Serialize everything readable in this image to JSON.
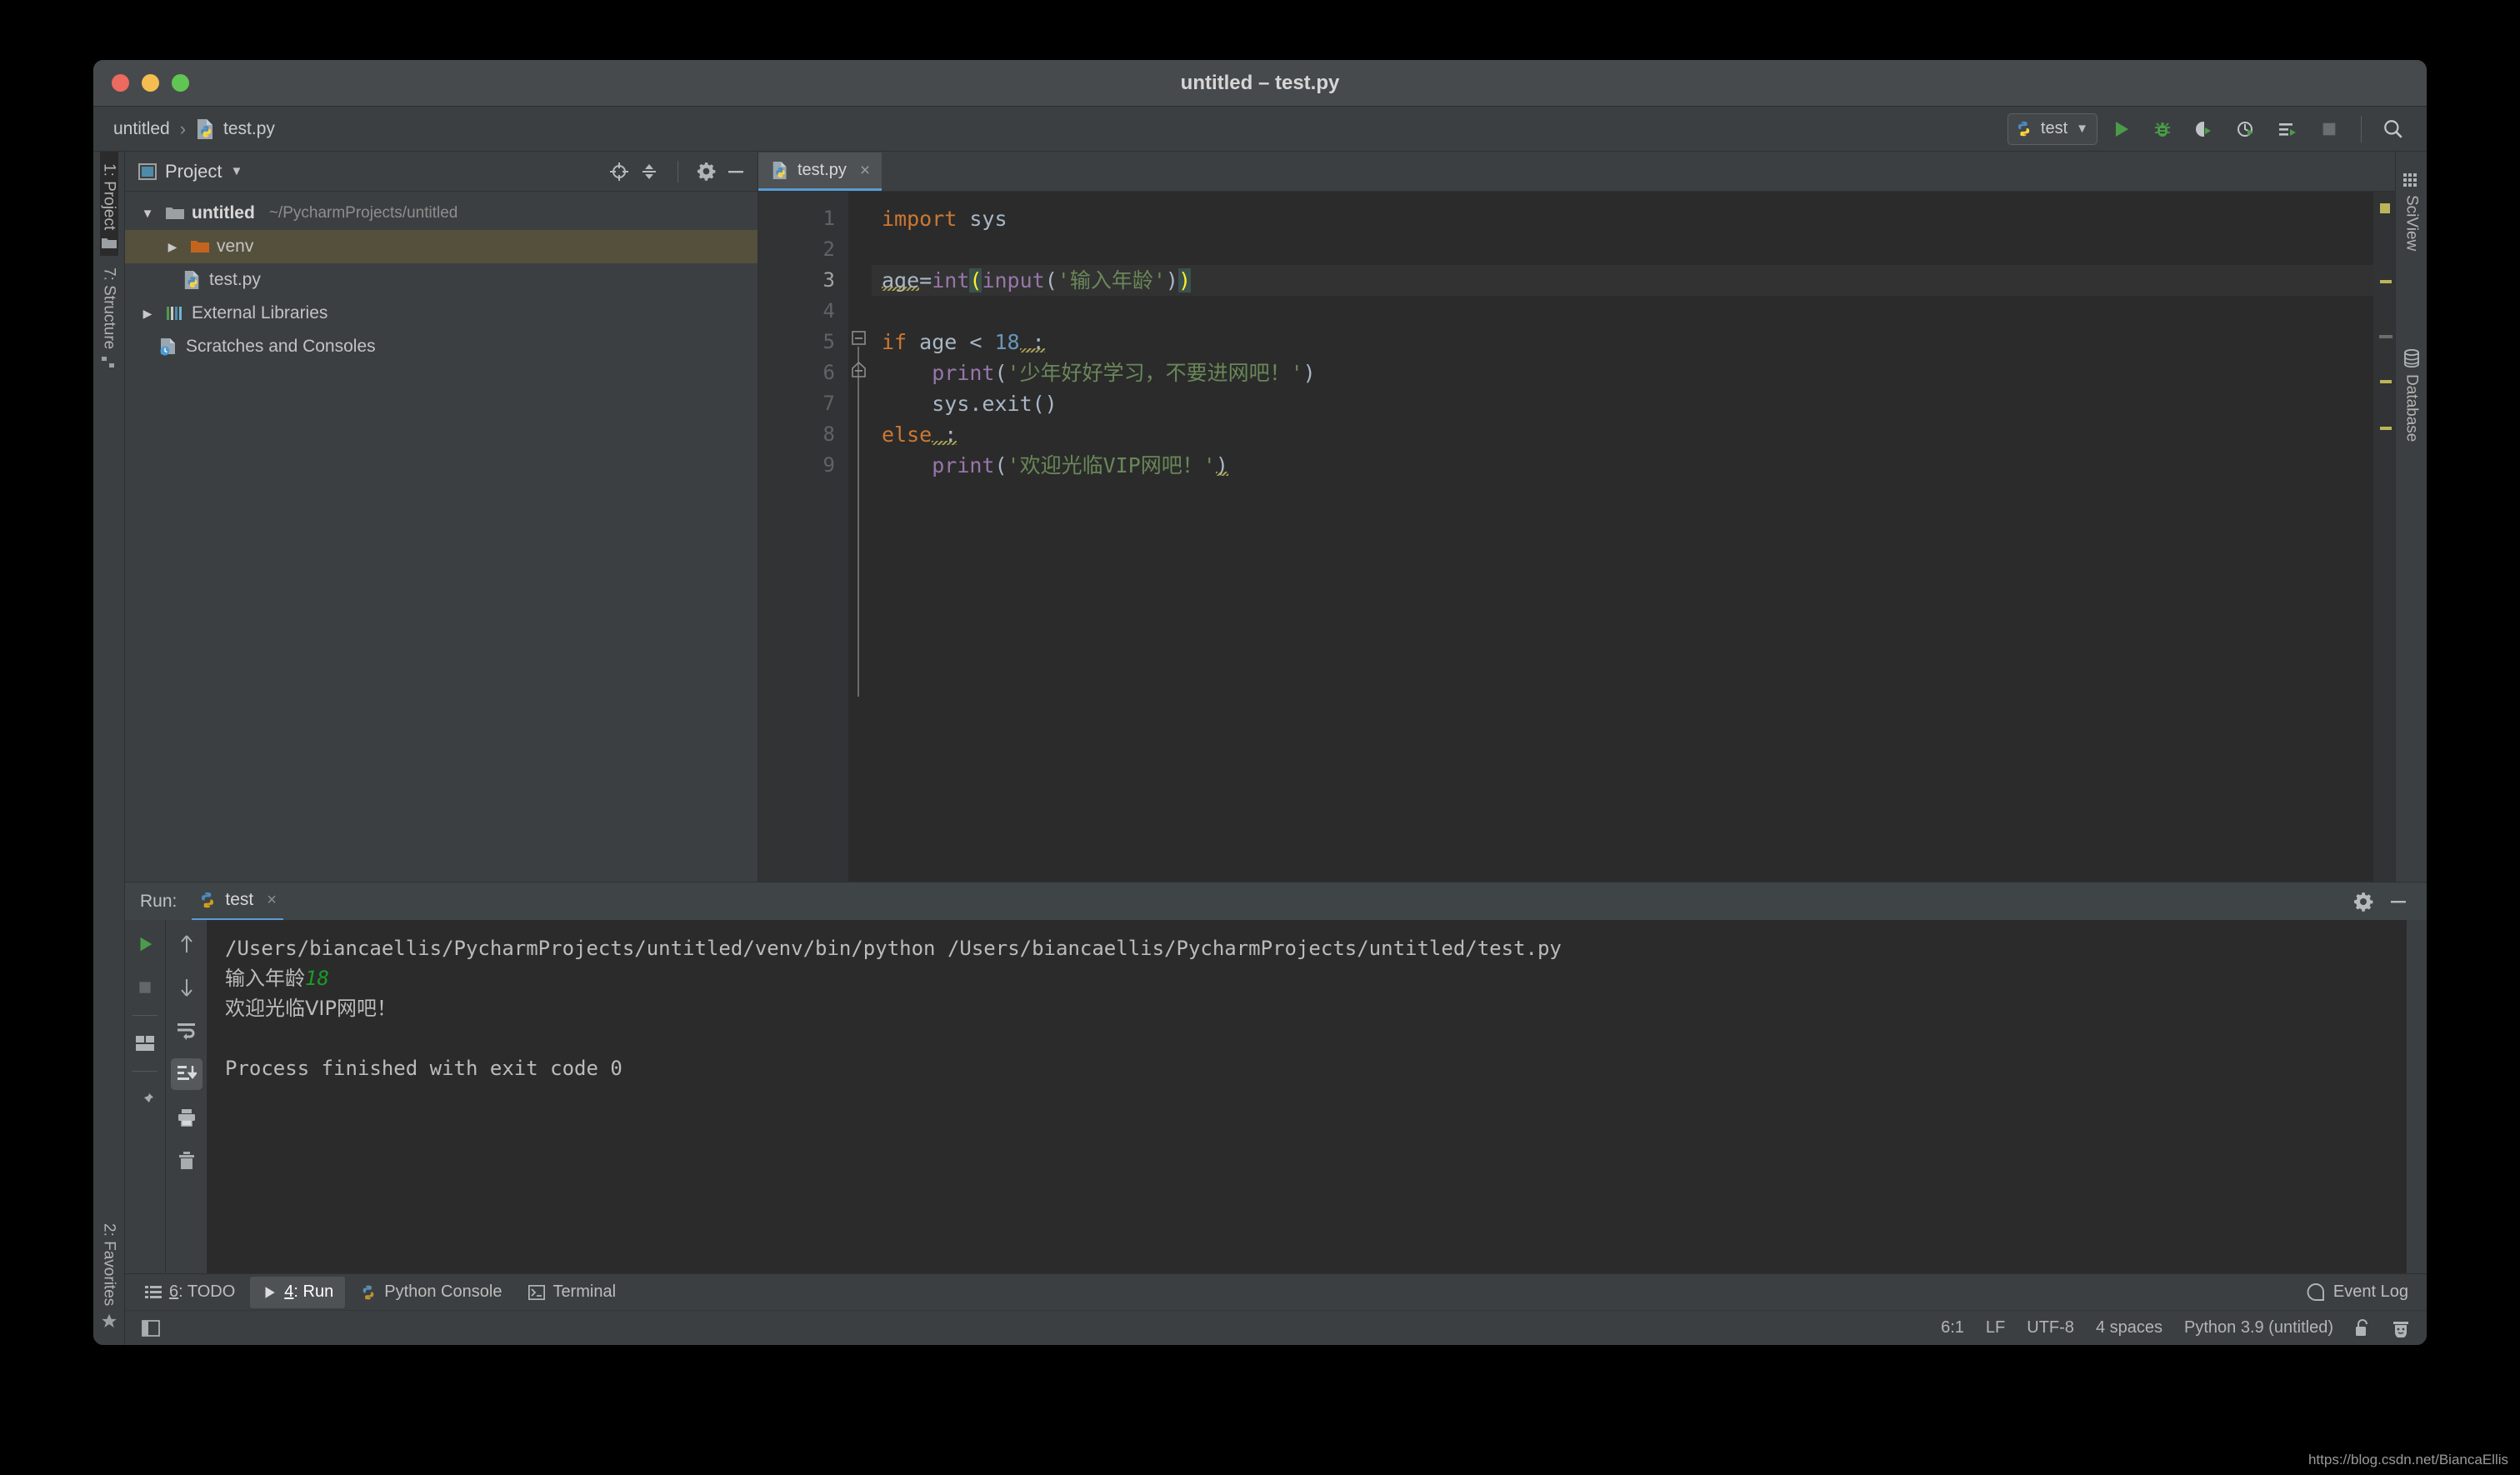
{
  "window": {
    "title": "untitled – test.py",
    "controls": [
      "close",
      "minimize",
      "zoom"
    ]
  },
  "navbar": {
    "breadcrumb": [
      {
        "label": "untitled",
        "icon": ""
      },
      {
        "label": "test.py",
        "icon": "python-file-icon"
      }
    ],
    "separator": "›",
    "run_config": {
      "label": "test",
      "icon": "python-icon",
      "chevron": "▼"
    },
    "buttons": [
      {
        "name": "run-button",
        "icon": "play-icon"
      },
      {
        "name": "debug-button",
        "icon": "bug-icon"
      },
      {
        "name": "run-coverage-button",
        "icon": "coverage-icon"
      },
      {
        "name": "profile-button",
        "icon": "profiler-icon"
      },
      {
        "name": "run-with-options-button",
        "icon": "run-list-icon"
      },
      {
        "name": "stop-button",
        "icon": "stop-icon"
      },
      {
        "name": "search-everywhere-button",
        "icon": "search-icon"
      }
    ]
  },
  "left_stripe": {
    "top": [
      {
        "label": "1: Project",
        "active": true,
        "icon": "folder-icon"
      },
      {
        "label": "7: Structure",
        "active": false,
        "icon": "structure-icon"
      }
    ],
    "bottom": [
      {
        "label": "2: Favorites",
        "active": false,
        "icon": "star-icon"
      }
    ]
  },
  "right_stripe": {
    "items": [
      {
        "label": "SciView",
        "icon": "grid-icon"
      },
      {
        "label": "Database",
        "icon": "database-icon"
      }
    ]
  },
  "project_panel": {
    "title": "Project",
    "title_chevron": "▼",
    "header_buttons": [
      {
        "name": "select-opened-file-button",
        "icon": "target-icon"
      },
      {
        "name": "collapse-all-button",
        "icon": "collapse-icon"
      },
      {
        "name": "settings-button",
        "icon": "gear-icon"
      },
      {
        "name": "hide-panel-button",
        "icon": "minimize-icon"
      }
    ],
    "tree": [
      {
        "name": "untitled",
        "path": "~/PycharmProjects/untitled",
        "icon": "folder-icon",
        "twisty": "▼",
        "depth": 0,
        "selected": false,
        "bold": true
      },
      {
        "name": "venv",
        "path": "",
        "icon": "folder-orange-icon",
        "twisty": "▶",
        "depth": 1,
        "selected": true,
        "bold": false
      },
      {
        "name": "test.py",
        "path": "",
        "icon": "python-file-icon",
        "twisty": "",
        "depth": 1,
        "selected": false,
        "bold": false
      },
      {
        "name": "External Libraries",
        "path": "",
        "icon": "libraries-icon",
        "twisty": "▶",
        "depth": 0,
        "selected": false,
        "bold": false
      },
      {
        "name": "Scratches and Consoles",
        "path": "",
        "icon": "scratches-icon",
        "twisty": "",
        "depth": 0,
        "selected": false,
        "bold": false
      }
    ]
  },
  "editor": {
    "tabs": [
      {
        "label": "test.py",
        "icon": "python-file-icon",
        "active": true,
        "close": "×"
      }
    ],
    "line_numbers": [
      "1",
      "2",
      "3",
      "4",
      "5",
      "6",
      "7",
      "8",
      "9"
    ],
    "current_line": 3,
    "lines": [
      {
        "n": 1,
        "text": "import sys"
      },
      {
        "n": 2,
        "text": ""
      },
      {
        "n": 3,
        "text": "age=int(input('输入年龄'))"
      },
      {
        "n": 4,
        "text": ""
      },
      {
        "n": 5,
        "text": "if age < 18 :"
      },
      {
        "n": 6,
        "text": "    print('少年好好学习，不要进网吧！')"
      },
      {
        "n": 7,
        "text": "    sys.exit()"
      },
      {
        "n": 8,
        "text": "else :"
      },
      {
        "n": 9,
        "text": "    print('欢迎光临VIP网吧！')"
      }
    ],
    "tokens": {
      "l1_kw": "import",
      "l1_mod": " sys",
      "l3_var": "age",
      "l3_eq": "=",
      "l3_int": "int",
      "l3_paren_open": "(",
      "l3_input": "input",
      "l3_paren2": "(",
      "l3_str": "'输入年龄'",
      "l3_paren2_close": ")",
      "l3_paren_close": ")",
      "l5_if": "if",
      "l5_cond": " age < ",
      "l5_num": "18",
      "l5_colon": " :",
      "l6_print": "print",
      "l6_open": "(",
      "l6_str": "'少年好好学习，不要进网吧！'",
      "l6_close": ")",
      "l7_code": "sys.exit()",
      "l8_else": "else",
      "l8_colon": " :",
      "l9_print": "print",
      "l9_open": "(",
      "l9_str": "'欢迎光临VIP网吧！'",
      "l9_close": ")"
    }
  },
  "run_panel": {
    "label": "Run:",
    "tab": {
      "label": "test",
      "icon": "python-icon",
      "close": "×"
    },
    "header_buttons": [
      {
        "name": "run-settings-button",
        "icon": "gear-icon"
      },
      {
        "name": "hide-run-panel-button",
        "icon": "minimize-icon"
      }
    ],
    "left_tools": [
      {
        "name": "rerun-button",
        "icon": "play-icon",
        "active": false
      },
      {
        "name": "stop-button",
        "icon": "stop-icon",
        "active": false
      },
      {
        "name": "divider",
        "icon": "divider",
        "active": false
      },
      {
        "name": "layout-button",
        "icon": "layout-icon",
        "active": false
      },
      {
        "name": "divider2",
        "icon": "divider",
        "active": false
      },
      {
        "name": "pin-tab-button",
        "icon": "pin-icon",
        "active": false
      }
    ],
    "right_tools": [
      {
        "name": "up-the-stack-button",
        "icon": "arrow-up-icon",
        "active": false
      },
      {
        "name": "down-the-stack-button",
        "icon": "arrow-down-icon",
        "active": false
      },
      {
        "name": "soft-wrap-button",
        "icon": "wrap-icon",
        "active": false
      },
      {
        "name": "scroll-to-end-button",
        "icon": "scroll-end-icon",
        "active": true
      },
      {
        "name": "print-button",
        "icon": "printer-icon",
        "active": false
      },
      {
        "name": "clear-all-button",
        "icon": "trash-icon",
        "active": false
      }
    ],
    "console": {
      "command": "/Users/biancaellis/PycharmProjects/untitled/venv/bin/python /Users/biancaellis/PycharmProjects/untitled/test.py",
      "prompt_text": "输入年龄",
      "user_input": "18",
      "output": "欢迎光临VIP网吧！",
      "blank": "",
      "exit_line": "Process finished with exit code 0"
    }
  },
  "bottom_tabs": [
    {
      "num": "6",
      "label": ": TODO",
      "icon": "todo-icon",
      "active": false
    },
    {
      "num": "4",
      "label": ": Run",
      "icon": "play-icon",
      "active": true
    },
    {
      "num": "",
      "label": "Python Console",
      "icon": "python-icon",
      "active": false
    },
    {
      "num": "",
      "label": "Terminal",
      "icon": "terminal-icon",
      "active": false
    }
  ],
  "event_log": {
    "label": "Event Log",
    "icon": "balloon-icon"
  },
  "statusbar": {
    "left_icon": "layout-toggle-icon",
    "items": [
      "6:1",
      "LF",
      "UTF-8",
      "4 spaces",
      "Python 3.9 (untitled)"
    ],
    "icons": [
      {
        "name": "lock-icon"
      },
      {
        "name": "inspector-icon"
      }
    ]
  },
  "watermark": "https://blog.csdn.net/BiancaEllis",
  "colors": {
    "accent": "#5a9bd5",
    "keyword": "#cc7832",
    "string": "#6a8759",
    "function": "#9876aa",
    "number": "#6897bb",
    "default_text": "#a9b7c6",
    "editor_bg": "#2b2b2b",
    "panel_bg": "#3c3f41",
    "selection": "#55503c",
    "input_green": "#1a9b26"
  }
}
